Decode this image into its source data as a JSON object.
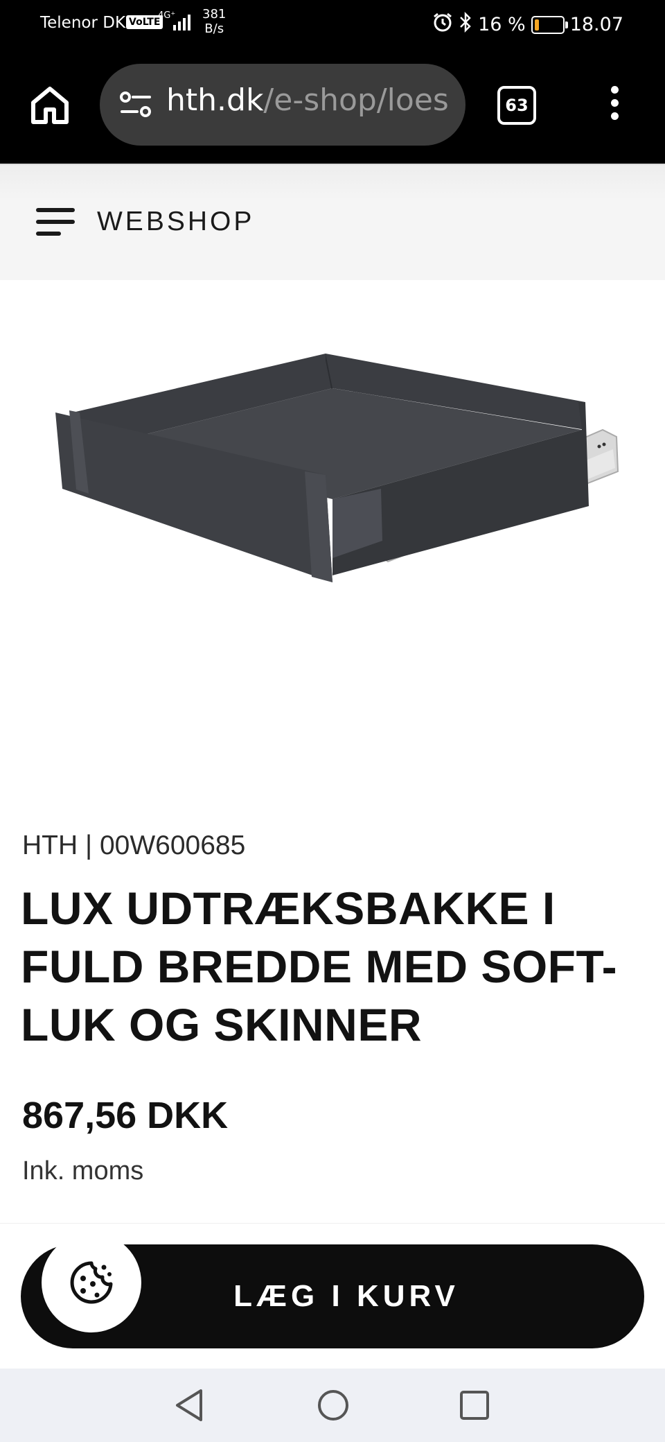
{
  "status_bar": {
    "carrier": "Telenor DK",
    "volte": "VoLTE",
    "network": "4G⁺",
    "speed_value": "381",
    "speed_unit": "B/s",
    "battery": "16 %",
    "battery_level_percent": 16,
    "time": "18.07"
  },
  "browser": {
    "url_domain": "hth.dk",
    "url_path": "/e-shop/loes",
    "tab_count": "63"
  },
  "header": {
    "menu_label": "WEBSHOP"
  },
  "product": {
    "meta": "HTH | 00W600685",
    "title": "LUX UDTRÆKSBAKKE I FULD BREDDE MED SOFT-LUK OG SKINNER",
    "price": "867,56 DKK",
    "vat_note": "Ink. moms",
    "image": "anthracite drawer tray with soft-close rails"
  },
  "actions": {
    "add_to_cart": "LÆG I KURV",
    "cookie_icon": "cookie-icon"
  },
  "colors": {
    "accent": "#0d0d0d",
    "header_bg": "#f5f5f5",
    "battery_low": "#f5a623"
  }
}
